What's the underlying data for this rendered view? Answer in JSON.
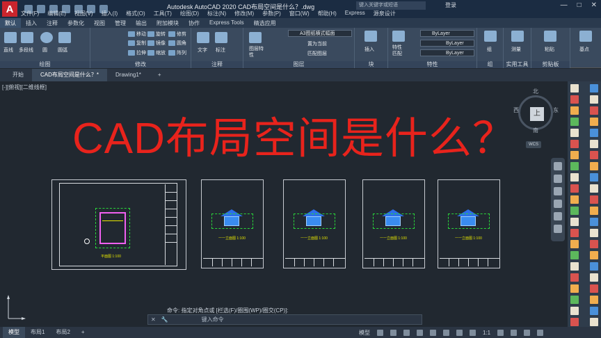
{
  "app": {
    "title": "Autodesk AutoCAD 2020    CAD布局空间是什么？.dwg",
    "search_placeholder": "键入关键字或短语",
    "login": "登录",
    "window_buttons": [
      "—",
      "□",
      "✕"
    ]
  },
  "menu": [
    "文件(F)",
    "编辑(E)",
    "视图(V)",
    "插入(I)",
    "格式(O)",
    "工具(T)",
    "绘图(D)",
    "标注(N)",
    "修改(M)",
    "参数(P)",
    "窗口(W)",
    "帮助(H)",
    "Express",
    "源泉设计"
  ],
  "ribbon_tabs": [
    "默认",
    "插入",
    "注释",
    "参数化",
    "视图",
    "管理",
    "输出",
    "附加模块",
    "协作",
    "Express Tools",
    "精选应用"
  ],
  "ribbon": {
    "draw": {
      "label": "绘图",
      "items": [
        "直线",
        "多段线",
        "圆",
        "圆弧"
      ]
    },
    "modify": {
      "label": "修改",
      "items": [
        "移动",
        "旋转",
        "修剪",
        "复制",
        "镜像",
        "圆角",
        "拉伸",
        "缩放",
        "阵列"
      ]
    },
    "annotation": {
      "label": "注释",
      "items": [
        "文字",
        "标注"
      ]
    },
    "layers": {
      "label": "图层",
      "items": [
        "图层特性",
        "A3图纸横式幅面",
        "置为当前",
        "匹配图层"
      ]
    },
    "block": {
      "label": "块",
      "items": [
        "插入"
      ]
    },
    "properties": {
      "label": "特性",
      "items": [
        "特性匹配",
        "ByLayer",
        "ByLayer",
        "ByLayer"
      ]
    },
    "groups": {
      "label": "组",
      "items": [
        "组"
      ]
    },
    "utilities": {
      "label": "实用工具",
      "items": [
        "测量"
      ]
    },
    "clipboard": {
      "label": "剪贴板",
      "items": [
        "粘贴"
      ]
    },
    "base": {
      "label": "",
      "items": [
        "基点"
      ]
    }
  },
  "doc_tabs": [
    "开始",
    "CAD布局空间是什么？*",
    "Drawing1*"
  ],
  "viewport_label": "[-][俯视][二维线框]",
  "headline": "CAD布局空间是什么？",
  "viewcube": {
    "face": "上",
    "north": "北",
    "south": "南",
    "east": "东",
    "west": "西",
    "wcs": "WCS"
  },
  "sheets": {
    "plan_caption": "平面图 1:100",
    "elevation_captions": [
      "一一立面图 1:100",
      "一一立面图 1:100",
      "一一立面图 1:100",
      "一一立面图 1:100"
    ]
  },
  "command": {
    "history": "命令: 指定对角点或 [栏选(F)/圈围(WP)/圈交(CP)]:",
    "placeholder": "键入命令"
  },
  "layout_tabs": [
    "模型",
    "布局1",
    "布局2",
    "+"
  ],
  "status": {
    "model": "模型",
    "scale": "1:1"
  }
}
